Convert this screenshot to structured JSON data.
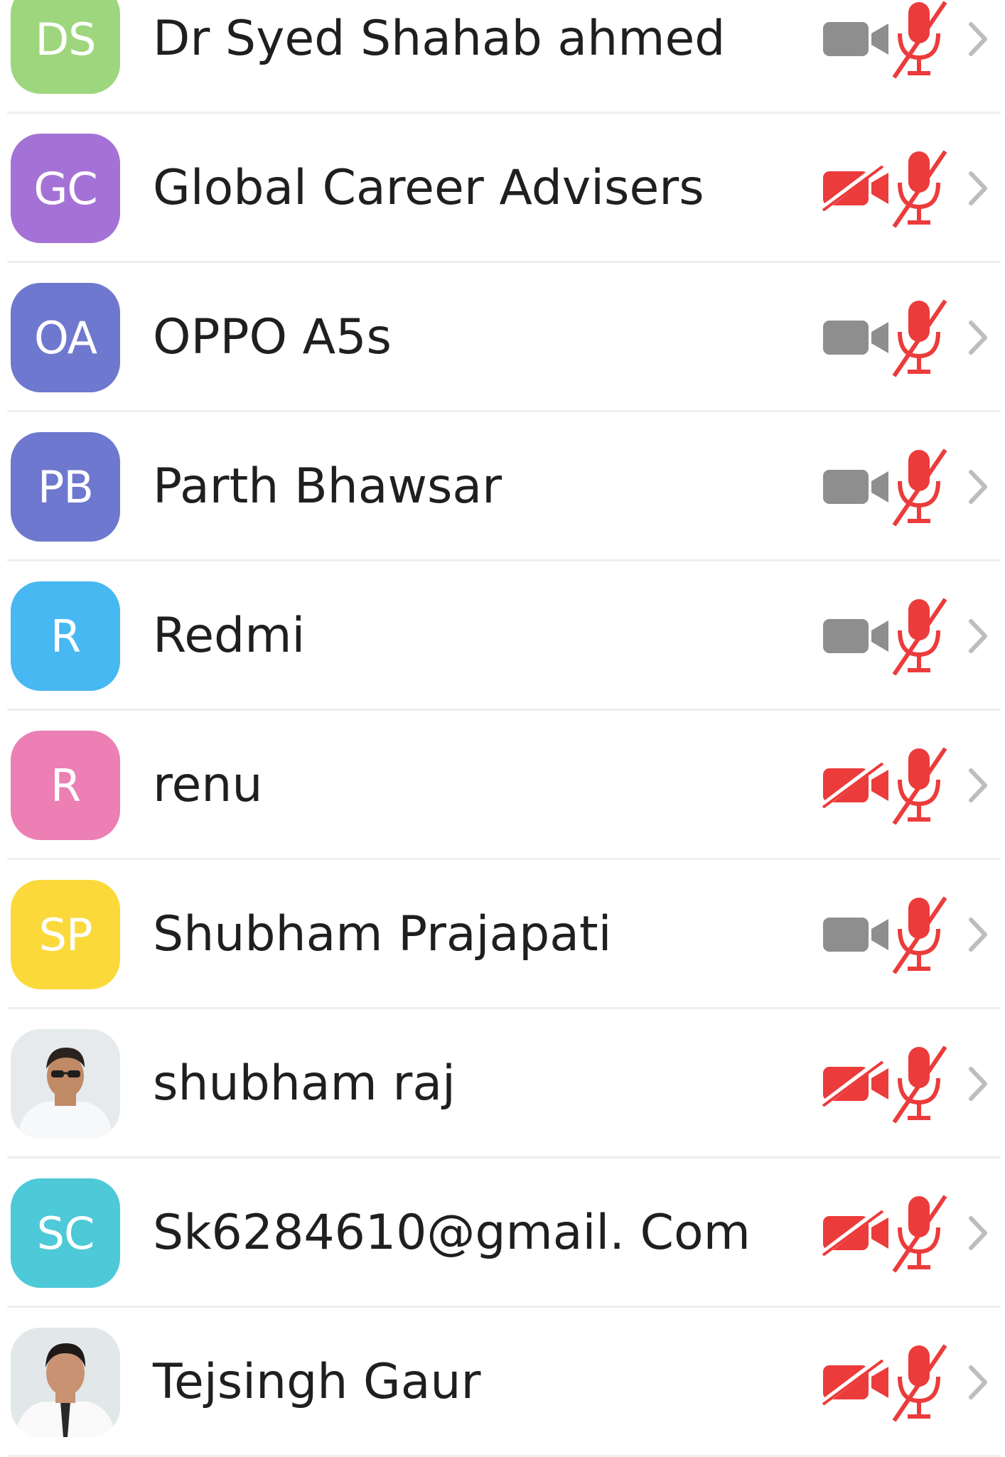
{
  "participants": [
    {
      "initials": "DS",
      "name": "Dr Syed Shahab ahmed",
      "avatar_color": "#9ed67e",
      "video": "off",
      "audio": "muted"
    },
    {
      "initials": "GC",
      "name": "Global Career Advisers",
      "avatar_color": "#a472d6",
      "video": "off-red",
      "audio": "muted"
    },
    {
      "initials": "OA",
      "name": "OPPO A5s",
      "avatar_color": "#6f78cf",
      "video": "off",
      "audio": "muted"
    },
    {
      "initials": "PB",
      "name": "Parth Bhawsar",
      "avatar_color": "#6f78cf",
      "video": "off",
      "audio": "muted"
    },
    {
      "initials": "R",
      "name": "Redmi",
      "avatar_color": "#47b8f2",
      "video": "off",
      "audio": "muted"
    },
    {
      "initials": "R",
      "name": "renu",
      "avatar_color": "#ec7fb4",
      "video": "off-red",
      "audio": "muted"
    },
    {
      "initials": "SP",
      "name": "Shubham Prajapati",
      "avatar_color": "#fbd93a",
      "video": "off",
      "audio": "muted"
    },
    {
      "initials": "",
      "name": "shubham raj",
      "avatar_color": "",
      "video": "off-red",
      "audio": "muted"
    },
    {
      "initials": "SC",
      "name": "Sk6284610@gmail. Com",
      "avatar_color": "#4dc9d8",
      "video": "off-red",
      "audio": "muted"
    },
    {
      "initials": "",
      "name": "Tejsingh Gaur",
      "avatar_color": "",
      "video": "off-red",
      "audio": "muted"
    }
  ],
  "colors": {
    "muted_red": "#ec3b3b",
    "camera_gray": "#8e8e8e",
    "chevron_gray": "#bdbdbd"
  },
  "icons": {
    "camera": "video-camera-icon",
    "camera_off": "video-camera-off-icon",
    "mic_muted": "microphone-muted-icon",
    "chevron": "chevron-right-icon"
  }
}
